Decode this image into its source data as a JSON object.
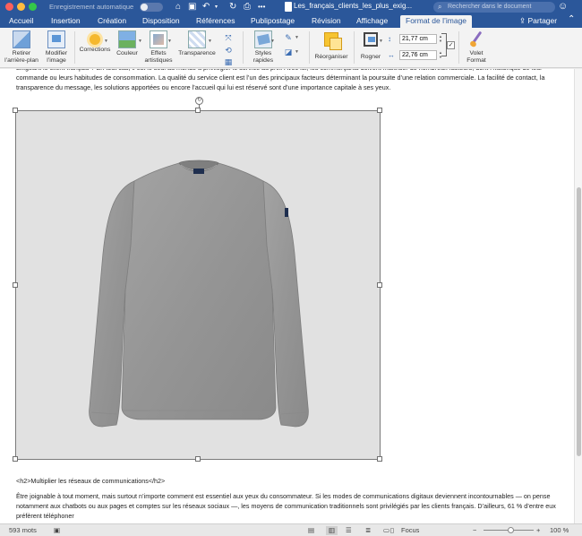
{
  "window": {
    "autosave_label": "Enregistrement automatique",
    "doc_title": "Les_français_clients_les_plus_exig...",
    "search_placeholder": "Rechercher dans le document"
  },
  "tabs": [
    {
      "label": "Accueil"
    },
    {
      "label": "Insertion"
    },
    {
      "label": "Création"
    },
    {
      "label": "Disposition"
    },
    {
      "label": "Références"
    },
    {
      "label": "Publipostage"
    },
    {
      "label": "Révision"
    },
    {
      "label": "Affichage"
    },
    {
      "label": "Format de l’image",
      "active": true
    }
  ],
  "share_label": "Partager",
  "ribbon": {
    "remove_background": [
      "Retirer",
      "l’arrière-plan"
    ],
    "modify_image": [
      "Modifier",
      "l’image"
    ],
    "corrections": "Corrections",
    "color": "Couleur",
    "artistic_effects": [
      "Effets",
      "artistiques"
    ],
    "transparency": "Transparence",
    "quick_styles": [
      "Styles",
      "rapides"
    ],
    "arrange": "Réorganiser",
    "crop": "Rogner",
    "height": "21,77 cm",
    "width": "22,76 cm",
    "format_pane": [
      "Volet",
      "Format"
    ]
  },
  "document": {
    "para_top": "Exigeant le client français ? En tout cas, il est le seul au monde à privilégier le service au prix. Avec lui, les commerçants doivent maîtriser de nombreux facteurs, dont l’historique de leur commande ou leurs habitudes de consommation. La qualité du service client est l’un des principaux facteurs déterminant la poursuite d’une relation commerciale. La facilité de contact, la transparence du message, les solutions apportées ou encore l’accueil qui lui est réservé sont d’une importance capitale à ses yeux.",
    "h2_line": "<h2>Multiplier les réseaux de communications</h2>",
    "para_bottom": "Être joignable à tout moment, mais surtout n’importe comment est essentiel aux yeux du consommateur. Si les modes de communications digitaux deviennent incontournables — on pense notamment aux chatbots ou aux pages et comptes sur les réseaux sociaux —, les moyens de communication traditionnels sont privilégiés par les clients français. D’ailleurs, 61 % d’entre eux préfèrent téléphoner"
  },
  "status": {
    "word_count": "593 mots",
    "focus_label": "Focus",
    "zoom": "100 %"
  },
  "colors": {
    "accent": "#2b579a",
    "sweater": "#9a9a9a",
    "image_bg": "#e1e1e1"
  }
}
